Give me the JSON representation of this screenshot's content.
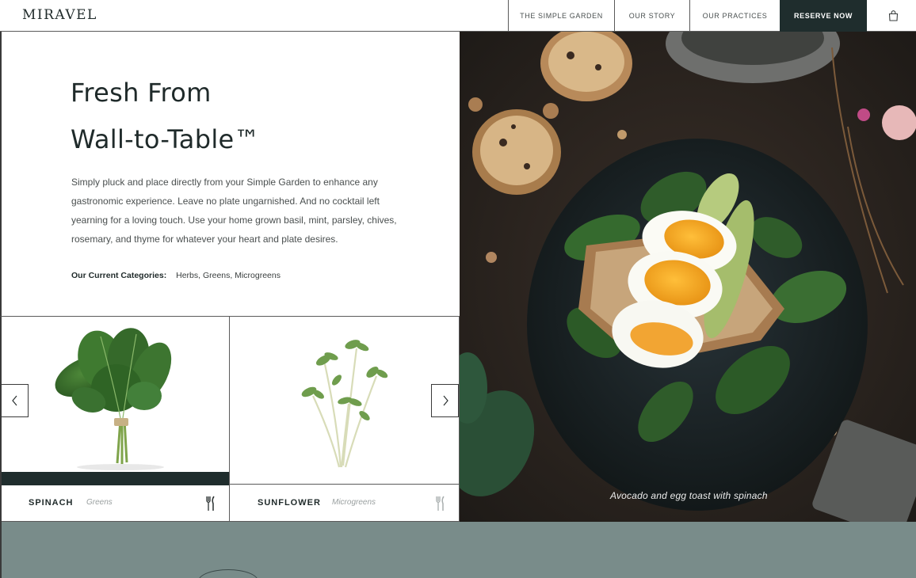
{
  "header": {
    "logo": "MIRAVEL",
    "nav": [
      {
        "label": "THE SIMPLE GARDEN"
      },
      {
        "label": "OUR STORY"
      },
      {
        "label": "OUR PRACTICES"
      }
    ],
    "reserve_label": "RESERVE NOW",
    "cart_icon": "shopping-bag-icon"
  },
  "intro": {
    "headline_line1": "Fresh From",
    "headline_line2": "Wall-to-Table™",
    "body": "Simply pluck and place directly from your Simple Garden to enhance any gastronomic experience. Leave no plate ungarnished. And no cocktail left yearning for a loving touch. Use your home grown basil, mint, parsley, chives, rosemary, and thyme for whatever your heart and plate desires.",
    "categories_label": "Our Current Categories:",
    "categories_value": "Herbs, Greens, Microgreens"
  },
  "products": [
    {
      "name": "SPINACH",
      "category": "Greens",
      "icon": "fork-knife-icon"
    },
    {
      "name": "SUNFLOWER",
      "category": "Microgreens",
      "icon": "fork-knife-icon"
    }
  ],
  "carousel": {
    "prev_icon": "chevron-left-icon",
    "next_icon": "chevron-right-icon"
  },
  "photo": {
    "caption": "Avocado and egg toast with spinach"
  },
  "colors": {
    "dark_teal": "#1f2d2d",
    "band": "#798c8a",
    "text": "#1f2a2a"
  }
}
